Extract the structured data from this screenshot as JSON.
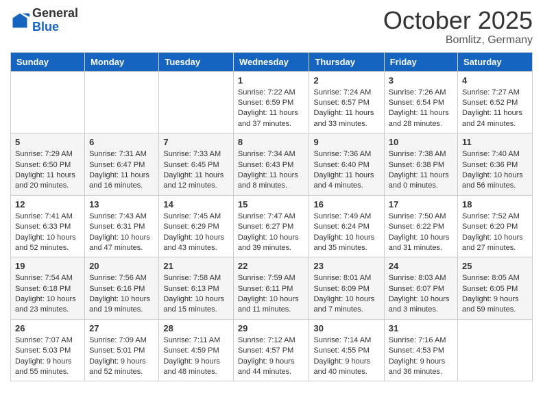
{
  "header": {
    "logo_general": "General",
    "logo_blue": "Blue",
    "month": "October 2025",
    "location": "Bomlitz, Germany"
  },
  "days_of_week": [
    "Sunday",
    "Monday",
    "Tuesday",
    "Wednesday",
    "Thursday",
    "Friday",
    "Saturday"
  ],
  "weeks": [
    [
      {
        "day": "",
        "info": ""
      },
      {
        "day": "",
        "info": ""
      },
      {
        "day": "",
        "info": ""
      },
      {
        "day": "1",
        "info": "Sunrise: 7:22 AM\nSunset: 6:59 PM\nDaylight: 11 hours and 37 minutes."
      },
      {
        "day": "2",
        "info": "Sunrise: 7:24 AM\nSunset: 6:57 PM\nDaylight: 11 hours and 33 minutes."
      },
      {
        "day": "3",
        "info": "Sunrise: 7:26 AM\nSunset: 6:54 PM\nDaylight: 11 hours and 28 minutes."
      },
      {
        "day": "4",
        "info": "Sunrise: 7:27 AM\nSunset: 6:52 PM\nDaylight: 11 hours and 24 minutes."
      }
    ],
    [
      {
        "day": "5",
        "info": "Sunrise: 7:29 AM\nSunset: 6:50 PM\nDaylight: 11 hours and 20 minutes."
      },
      {
        "day": "6",
        "info": "Sunrise: 7:31 AM\nSunset: 6:47 PM\nDaylight: 11 hours and 16 minutes."
      },
      {
        "day": "7",
        "info": "Sunrise: 7:33 AM\nSunset: 6:45 PM\nDaylight: 11 hours and 12 minutes."
      },
      {
        "day": "8",
        "info": "Sunrise: 7:34 AM\nSunset: 6:43 PM\nDaylight: 11 hours and 8 minutes."
      },
      {
        "day": "9",
        "info": "Sunrise: 7:36 AM\nSunset: 6:40 PM\nDaylight: 11 hours and 4 minutes."
      },
      {
        "day": "10",
        "info": "Sunrise: 7:38 AM\nSunset: 6:38 PM\nDaylight: 11 hours and 0 minutes."
      },
      {
        "day": "11",
        "info": "Sunrise: 7:40 AM\nSunset: 6:36 PM\nDaylight: 10 hours and 56 minutes."
      }
    ],
    [
      {
        "day": "12",
        "info": "Sunrise: 7:41 AM\nSunset: 6:33 PM\nDaylight: 10 hours and 52 minutes."
      },
      {
        "day": "13",
        "info": "Sunrise: 7:43 AM\nSunset: 6:31 PM\nDaylight: 10 hours and 47 minutes."
      },
      {
        "day": "14",
        "info": "Sunrise: 7:45 AM\nSunset: 6:29 PM\nDaylight: 10 hours and 43 minutes."
      },
      {
        "day": "15",
        "info": "Sunrise: 7:47 AM\nSunset: 6:27 PM\nDaylight: 10 hours and 39 minutes."
      },
      {
        "day": "16",
        "info": "Sunrise: 7:49 AM\nSunset: 6:24 PM\nDaylight: 10 hours and 35 minutes."
      },
      {
        "day": "17",
        "info": "Sunrise: 7:50 AM\nSunset: 6:22 PM\nDaylight: 10 hours and 31 minutes."
      },
      {
        "day": "18",
        "info": "Sunrise: 7:52 AM\nSunset: 6:20 PM\nDaylight: 10 hours and 27 minutes."
      }
    ],
    [
      {
        "day": "19",
        "info": "Sunrise: 7:54 AM\nSunset: 6:18 PM\nDaylight: 10 hours and 23 minutes."
      },
      {
        "day": "20",
        "info": "Sunrise: 7:56 AM\nSunset: 6:16 PM\nDaylight: 10 hours and 19 minutes."
      },
      {
        "day": "21",
        "info": "Sunrise: 7:58 AM\nSunset: 6:13 PM\nDaylight: 10 hours and 15 minutes."
      },
      {
        "day": "22",
        "info": "Sunrise: 7:59 AM\nSunset: 6:11 PM\nDaylight: 10 hours and 11 minutes."
      },
      {
        "day": "23",
        "info": "Sunrise: 8:01 AM\nSunset: 6:09 PM\nDaylight: 10 hours and 7 minutes."
      },
      {
        "day": "24",
        "info": "Sunrise: 8:03 AM\nSunset: 6:07 PM\nDaylight: 10 hours and 3 minutes."
      },
      {
        "day": "25",
        "info": "Sunrise: 8:05 AM\nSunset: 6:05 PM\nDaylight: 9 hours and 59 minutes."
      }
    ],
    [
      {
        "day": "26",
        "info": "Sunrise: 7:07 AM\nSunset: 5:03 PM\nDaylight: 9 hours and 55 minutes."
      },
      {
        "day": "27",
        "info": "Sunrise: 7:09 AM\nSunset: 5:01 PM\nDaylight: 9 hours and 52 minutes."
      },
      {
        "day": "28",
        "info": "Sunrise: 7:11 AM\nSunset: 4:59 PM\nDaylight: 9 hours and 48 minutes."
      },
      {
        "day": "29",
        "info": "Sunrise: 7:12 AM\nSunset: 4:57 PM\nDaylight: 9 hours and 44 minutes."
      },
      {
        "day": "30",
        "info": "Sunrise: 7:14 AM\nSunset: 4:55 PM\nDaylight: 9 hours and 40 minutes."
      },
      {
        "day": "31",
        "info": "Sunrise: 7:16 AM\nSunset: 4:53 PM\nDaylight: 9 hours and 36 minutes."
      },
      {
        "day": "",
        "info": ""
      }
    ]
  ]
}
